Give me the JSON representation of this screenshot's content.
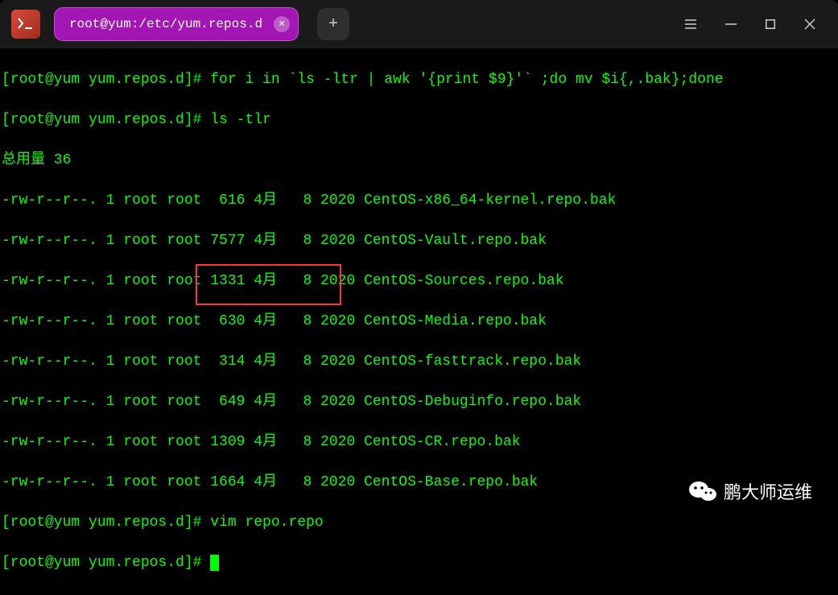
{
  "tab": {
    "title": "root@yum:/etc/yum.repos.d"
  },
  "terminal": {
    "lines": [
      "[root@yum yum.repos.d]# for i in `ls -ltr | awk '{print $9}'` ;do mv $i{,.bak};done",
      "[root@yum yum.repos.d]# ls -tlr",
      "总用量 36",
      "-rw-r--r--. 1 root root  616 4月   8 2020 CentOS-x86_64-kernel.repo.bak",
      "-rw-r--r--. 1 root root 7577 4月   8 2020 CentOS-Vault.repo.bak",
      "-rw-r--r--. 1 root root 1331 4月   8 2020 CentOS-Sources.repo.bak",
      "-rw-r--r--. 1 root root  630 4月   8 2020 CentOS-Media.repo.bak",
      "-rw-r--r--. 1 root root  314 4月   8 2020 CentOS-fasttrack.repo.bak",
      "-rw-r--r--. 1 root root  649 4月   8 2020 CentOS-Debuginfo.repo.bak",
      "-rw-r--r--. 1 root root 1309 4月   8 2020 CentOS-CR.repo.bak",
      "-rw-r--r--. 1 root root 1664 4月   8 2020 CentOS-Base.repo.bak",
      "[root@yum yum.repos.d]# vim repo.repo",
      "[root@yum yum.repos.d]# "
    ]
  },
  "watermark": {
    "text": "鹏大师运维"
  }
}
